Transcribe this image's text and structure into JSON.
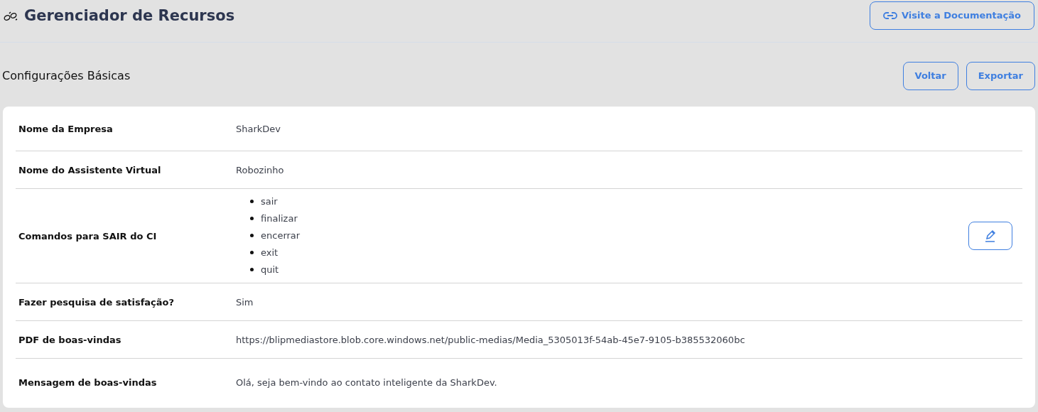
{
  "header": {
    "title": "Gerenciador de Recursos",
    "docs_link": "Visite a Documentação"
  },
  "section": {
    "title": "Configurações Básicas",
    "buttons": [
      "Voltar",
      "Exportar"
    ]
  },
  "rows": [
    {
      "kind": "text",
      "label": "Nome da Empresa",
      "value": "SharkDev",
      "editable": false
    },
    {
      "kind": "text",
      "label": "Nome do Assistente Virtual",
      "value": "Robozinho",
      "editable": false
    },
    {
      "kind": "list",
      "label": "Comandos para SAIR do CI",
      "items": [
        "sair",
        "finalizar",
        "encerrar",
        "exit",
        "quit"
      ],
      "editable": true
    },
    {
      "kind": "text",
      "label": "Fazer pesquisa de satisfação?",
      "value": "Sim",
      "editable": false
    },
    {
      "kind": "text",
      "label": "PDF de boas-vindas",
      "value": "https://blipmediastore.blob.core.windows.net/public-medias/Media_5305013f-54ab-45e7-9105-b385532060bc",
      "editable": false
    },
    {
      "kind": "text",
      "label": "Mensagem de boas-vindas",
      "value": "Olá, seja bem-vindo ao contato inteligente da SharkDev.",
      "editable": false
    }
  ]
}
